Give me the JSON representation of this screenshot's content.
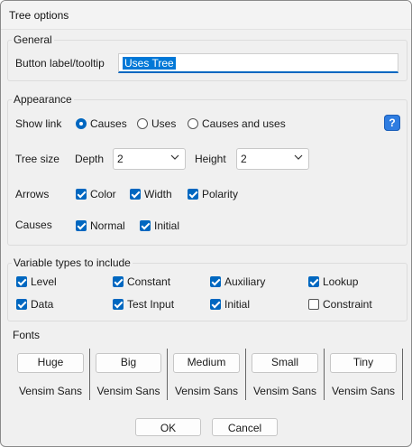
{
  "window": {
    "title": "Tree options"
  },
  "general": {
    "legend": "General",
    "label_text": "Button label/tooltip",
    "label_value": "Uses Tree"
  },
  "appearance": {
    "legend": "Appearance",
    "show_link": {
      "label": "Show link",
      "options": [
        "Causes",
        "Uses",
        "Causes and uses"
      ],
      "selected": "Causes"
    },
    "help_label": "?",
    "tree_size": {
      "label": "Tree size",
      "depth_label": "Depth",
      "depth_value": "2",
      "height_label": "Height",
      "height_value": "2"
    },
    "arrows": {
      "label": "Arrows",
      "items": [
        {
          "label": "Color",
          "checked": true
        },
        {
          "label": "Width",
          "checked": true
        },
        {
          "label": "Polarity",
          "checked": true
        }
      ]
    },
    "causes": {
      "label": "Causes",
      "items": [
        {
          "label": "Normal",
          "checked": true
        },
        {
          "label": "Initial",
          "checked": true
        }
      ]
    }
  },
  "variable_types": {
    "legend": "Variable types to include",
    "items": [
      {
        "label": "Level",
        "checked": true
      },
      {
        "label": "Constant",
        "checked": true
      },
      {
        "label": "Auxiliary",
        "checked": true
      },
      {
        "label": "Lookup",
        "checked": true
      },
      {
        "label": "Data",
        "checked": true
      },
      {
        "label": "Test Input",
        "checked": true
      },
      {
        "label": "Initial",
        "checked": true
      },
      {
        "label": "Constraint",
        "checked": false
      }
    ]
  },
  "fonts": {
    "legend": "Fonts",
    "items": [
      {
        "button": "Huge",
        "font": "Vensim Sans"
      },
      {
        "button": "Big",
        "font": "Vensim Sans"
      },
      {
        "button": "Medium",
        "font": "Vensim Sans"
      },
      {
        "button": "Small",
        "font": "Vensim Sans"
      },
      {
        "button": "Tiny",
        "font": "Vensim Sans"
      }
    ]
  },
  "footer": {
    "ok": "OK",
    "cancel": "Cancel"
  },
  "colors": {
    "accent": "#0067c0",
    "help": "#2f7de1"
  }
}
